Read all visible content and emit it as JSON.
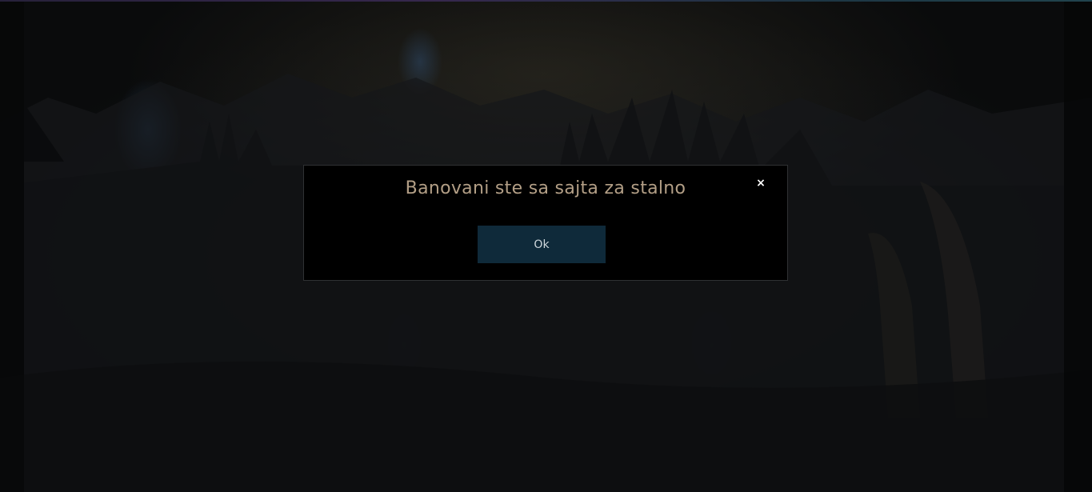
{
  "modal": {
    "title": "Banovani ste sa sajta za stalno",
    "close_symbol": "×",
    "ok_label": "Ok"
  },
  "colors": {
    "title_text": "#b39f86",
    "button_bg": "#0f2a3a",
    "modal_bg": "#000000"
  },
  "icons": {
    "close": "close-icon"
  }
}
